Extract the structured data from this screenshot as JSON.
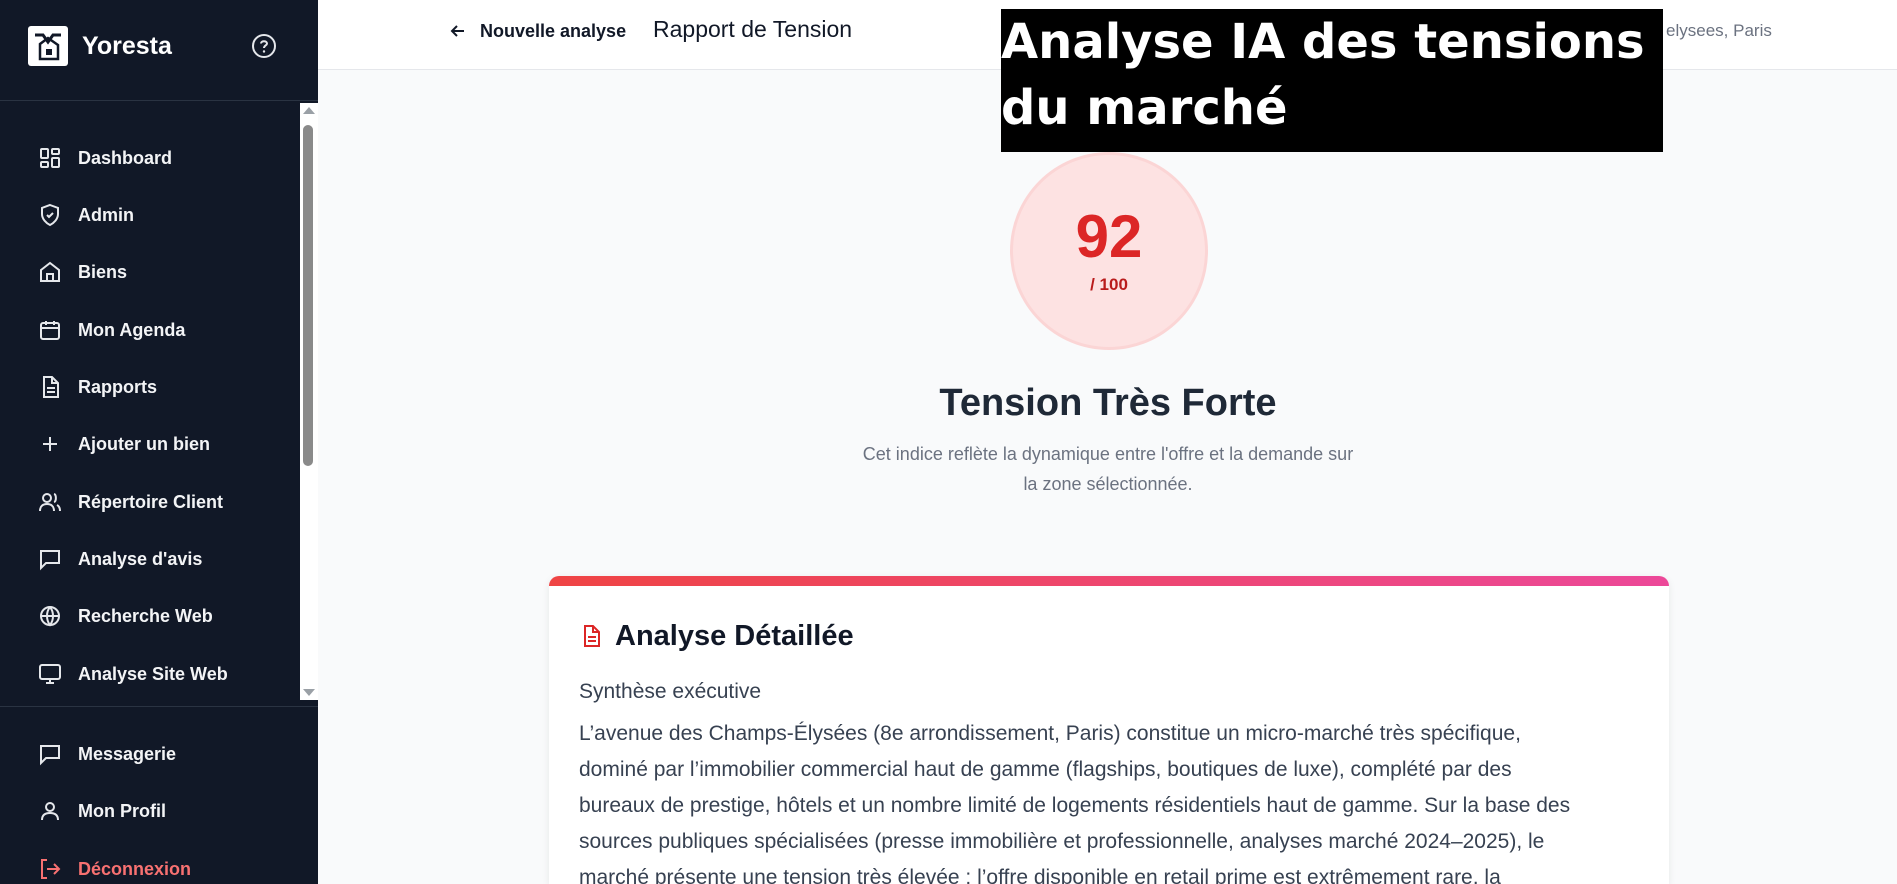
{
  "sidebar": {
    "brand": "Yoresta",
    "items": [
      {
        "label": "Dashboard",
        "icon": "dashboard-icon"
      },
      {
        "label": "Admin",
        "icon": "shield-icon"
      },
      {
        "label": "Biens",
        "icon": "home-icon"
      },
      {
        "label": "Mon Agenda",
        "icon": "calendar-icon"
      },
      {
        "label": "Rapports",
        "icon": "document-icon"
      },
      {
        "label": "Ajouter un bien",
        "icon": "plus-icon"
      },
      {
        "label": "Répertoire Client",
        "icon": "users-icon"
      },
      {
        "label": "Analyse d'avis",
        "icon": "message-icon"
      },
      {
        "label": "Recherche Web",
        "icon": "globe-icon"
      },
      {
        "label": "Analyse Site Web",
        "icon": "monitor-icon"
      }
    ],
    "bottom_items": [
      {
        "label": "Messagerie",
        "icon": "message-icon"
      },
      {
        "label": "Mon Profil",
        "icon": "user-icon"
      },
      {
        "label": "Déconnexion",
        "icon": "logout-icon"
      }
    ]
  },
  "header": {
    "back_label": "Nouvelle analyse",
    "title": "Rapport de Tension",
    "location": "Champs elysees, Paris"
  },
  "overlay": {
    "line1": "Analyse IA des tensions",
    "line2": "du marché"
  },
  "score": {
    "value": "92",
    "max": "/ 100",
    "label": "Tension Très Forte",
    "description_line1": "Cet indice reflète la dynamique entre l'offre et la demande sur",
    "description_line2": "la zone sélectionnée."
  },
  "analysis": {
    "title": "Analyse Détaillée",
    "section": "Synthèse exécutive",
    "lines": [
      "L’avenue des Champs-Élysées (8e arrondissement, Paris) constitue un micro-marché très spécifique,",
      "dominé par l’immobilier commercial haut de gamme (flagships, boutiques de luxe), complété par des",
      "bureaux de prestige, hôtels et un nombre limité de logements résidentiels haut de gamme. Sur la base des",
      "sources publiques spécialisées (presse immobilière et professionnelle, analyses marché 2024–2025), le",
      "marché présente une tension très élevée : l’offre disponible en retail prime est extrêmement rare, la"
    ]
  },
  "colors": {
    "sidebar_bg": "#111827",
    "accent_red": "#dc2626",
    "logout": "#f87171"
  }
}
